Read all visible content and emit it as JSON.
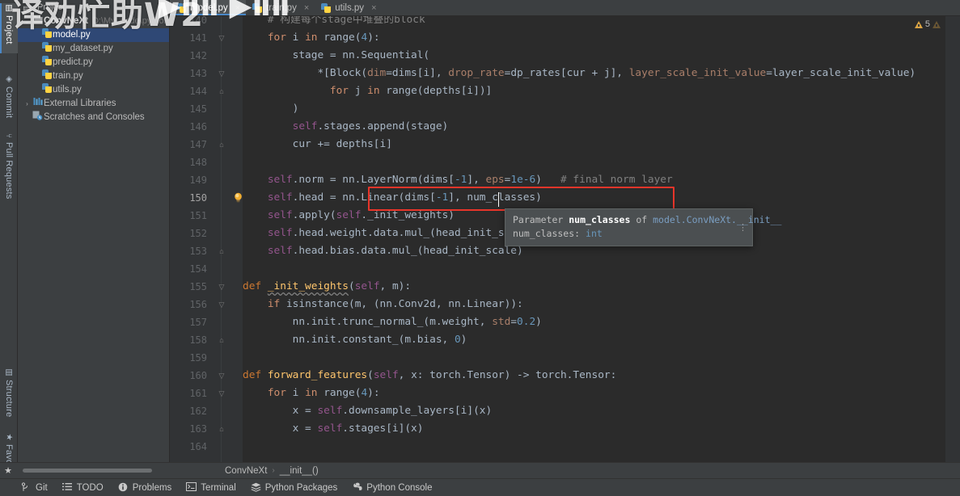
{
  "watermark": {
    "left_text": "译劝忙助W2",
    "right_text": "▶︎ⅡⅡ ▶︎ⅡⅡ"
  },
  "toolwindows": {
    "left": [
      {
        "id": "project",
        "label": "Project",
        "icon": "project-icon",
        "active": true
      },
      {
        "id": "commit",
        "label": "Commit",
        "icon": "commit-icon",
        "active": false
      },
      {
        "id": "pull-requests",
        "label": "Pull Requests",
        "icon": "pull-request-icon",
        "active": false
      }
    ],
    "left_bottom": [
      {
        "id": "structure",
        "label": "Structure",
        "icon": "structure-icon",
        "active": false
      },
      {
        "id": "favorites",
        "label": "Favorites",
        "icon": "star-icon",
        "active": false
      }
    ]
  },
  "project_panel": {
    "title": "Project",
    "tree": [
      {
        "label": "ConvNeXt",
        "path": "D:\\My_code\\pythonP",
        "icon": "folder-icon",
        "arrow": "⌄",
        "level": 0,
        "bold": true,
        "selected": false
      },
      {
        "label": "model.py",
        "path": "",
        "icon": "python-file-icon",
        "arrow": "",
        "level": 1,
        "bold": false,
        "selected": true
      },
      {
        "label": "my_dataset.py",
        "path": "",
        "icon": "python-file-icon",
        "arrow": "",
        "level": 1,
        "bold": false,
        "selected": false
      },
      {
        "label": "predict.py",
        "path": "",
        "icon": "python-file-icon",
        "arrow": "",
        "level": 1,
        "bold": false,
        "selected": false
      },
      {
        "label": "train.py",
        "path": "",
        "icon": "python-file-icon",
        "arrow": "",
        "level": 1,
        "bold": false,
        "selected": false
      },
      {
        "label": "utils.py",
        "path": "",
        "icon": "python-file-icon",
        "arrow": "",
        "level": 1,
        "bold": false,
        "selected": false
      },
      {
        "label": "External Libraries",
        "path": "",
        "icon": "library-icon",
        "arrow": "›",
        "level": 0,
        "bold": false,
        "selected": false
      },
      {
        "label": "Scratches and Consoles",
        "path": "",
        "icon": "scratches-icon",
        "arrow": "",
        "level": 0,
        "bold": false,
        "selected": false
      }
    ]
  },
  "tabs": [
    {
      "label": "model.py",
      "icon": "python-file-icon",
      "active": true,
      "close": "×"
    },
    {
      "label": "train.py",
      "icon": "python-file-icon",
      "active": false,
      "close": "×"
    },
    {
      "label": "utils.py",
      "icon": "python-file-icon",
      "active": false,
      "close": "×"
    }
  ],
  "inspection": {
    "warning_count": "5",
    "warning_icon": "warning-triangle-icon"
  },
  "editor": {
    "first_line": 140,
    "current_line": 150,
    "lines": [
      {
        "n": "140",
        "fold": "",
        "indent": 0
      },
      {
        "n": "141",
        "fold": "▽",
        "indent": 0
      },
      {
        "n": "142",
        "fold": "",
        "indent": 0
      },
      {
        "n": "143",
        "fold": "▽",
        "indent": 0
      },
      {
        "n": "144",
        "fold": "⌂",
        "indent": 0
      },
      {
        "n": "145",
        "fold": "",
        "indent": 0
      },
      {
        "n": "146",
        "fold": "",
        "indent": 0
      },
      {
        "n": "147",
        "fold": "⌂",
        "indent": 0
      },
      {
        "n": "148",
        "fold": "",
        "indent": 0
      },
      {
        "n": "149",
        "fold": "",
        "indent": 0
      },
      {
        "n": "150",
        "fold": "",
        "indent": 0
      },
      {
        "n": "151",
        "fold": "",
        "indent": 0
      },
      {
        "n": "152",
        "fold": "",
        "indent": 0
      },
      {
        "n": "153",
        "fold": "⌂",
        "indent": 0
      },
      {
        "n": "154",
        "fold": "",
        "indent": 0
      },
      {
        "n": "155",
        "fold": "▽",
        "indent": 0
      },
      {
        "n": "156",
        "fold": "▽",
        "indent": 0
      },
      {
        "n": "157",
        "fold": "",
        "indent": 0
      },
      {
        "n": "158",
        "fold": "⌂",
        "indent": 0
      },
      {
        "n": "159",
        "fold": "",
        "indent": 0
      },
      {
        "n": "160",
        "fold": "▽",
        "indent": 0
      },
      {
        "n": "161",
        "fold": "▽",
        "indent": 0
      },
      {
        "n": "162",
        "fold": "",
        "indent": 0
      },
      {
        "n": "163",
        "fold": "⌂",
        "indent": 0
      },
      {
        "n": "164",
        "fold": "",
        "indent": 0
      }
    ],
    "source": [
      "            # 构建每个stage中堆叠的block",
      "            for i in range(4):",
      "                stage = nn.Sequential(",
      "                    *[Block(dim=dims[i], drop_rate=dp_rates[cur + j], layer_scale_init_value=layer_scale_init_value)",
      "                      for j in range(depths[i])]",
      "                )",
      "                self.stages.append(stage)",
      "                cur += depths[i]",
      "",
      "            self.norm = nn.LayerNorm(dims[-1], eps=1e-6)  # final norm layer",
      "            self.head = nn.Linear(dims[-1], num_classes)",
      "            self.apply(self._init_weights)",
      "            self.head.weight.data.mul_(head_init_scale)",
      "            self.head.bias.data.mul_(head_init_scale)",
      "",
      "        def _init_weights(self, m):",
      "            if isinstance(m, (nn.Conv2d, nn.Linear)):",
      "                nn.init.trunc_normal_(m.weight, std=0.2)",
      "                nn.init.constant_(m.bias, 0)",
      "",
      "        def forward_features(self, x: torch.Tensor) -> torch.Tensor:",
      "            for i in range(4):",
      "                x = self.downsample_layers[i](x)",
      "                x = self.stages[i](x)",
      ""
    ],
    "highlight_box_line": "150",
    "lightbulb_icon": "lightbulb-intention-icon"
  },
  "param_popup": {
    "line1_prefix": "Parameter ",
    "line1_name": "num_classes",
    "line1_mid": " of ",
    "line1_ref": "model.ConvNeXt.__init__",
    "line2_name": "num_classes: ",
    "line2_type": "int",
    "more_icon": "more-options-icon"
  },
  "breadcrumb": {
    "star_icon": "bookmark-star-icon",
    "items": [
      "ConvNeXt",
      "__init__()"
    ],
    "separator": "›"
  },
  "statusbar": {
    "items": [
      {
        "label": "Git",
        "icon": "git-branch-icon"
      },
      {
        "label": "TODO",
        "icon": "todo-list-icon"
      },
      {
        "label": "Problems",
        "icon": "problems-icon"
      },
      {
        "label": "Terminal",
        "icon": "terminal-icon"
      },
      {
        "label": "Python Packages",
        "icon": "packages-icon"
      },
      {
        "label": "Python Console",
        "icon": "python-console-icon"
      }
    ]
  },
  "colors": {
    "editor_bg": "#2b2b2b",
    "panel_bg": "#3c3f41",
    "gutter_bg": "#313335",
    "accent_blue": "#4a88c7",
    "selection_blue": "#2f4875",
    "highlight_red": "#e8352a",
    "warning_amber": "#d9a343"
  }
}
